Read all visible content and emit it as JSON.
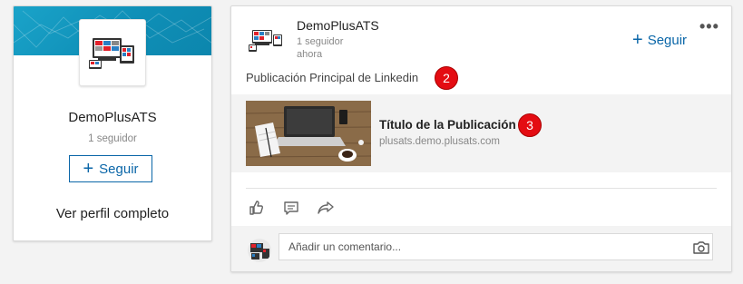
{
  "profile": {
    "name": "DemoPlusATS",
    "followers": "1 seguidor",
    "follow_label": "Seguir",
    "plus_icon": "+",
    "full_profile_label": "Ver perfil completo"
  },
  "post": {
    "author": "DemoPlusATS",
    "followers": "1 seguidor",
    "time": "ahora",
    "follow_label": "Seguir",
    "plus_icon": "+",
    "more_icon": "•••",
    "text": "Publicación Principal de Linkedin",
    "badge_text": "2",
    "link": {
      "title": "Título de la Publicación",
      "url": "plusats.demo.plusats.com",
      "badge_text": "3"
    },
    "actions": [
      "like-icon",
      "comment-icon",
      "share-icon"
    ],
    "comment": {
      "placeholder": "Añadir un comentario...",
      "camera_icon": "camera-icon"
    }
  },
  "colors": {
    "accent": "#0a66a8",
    "badge": "#e40c12",
    "banner": "#1aa3c9"
  }
}
